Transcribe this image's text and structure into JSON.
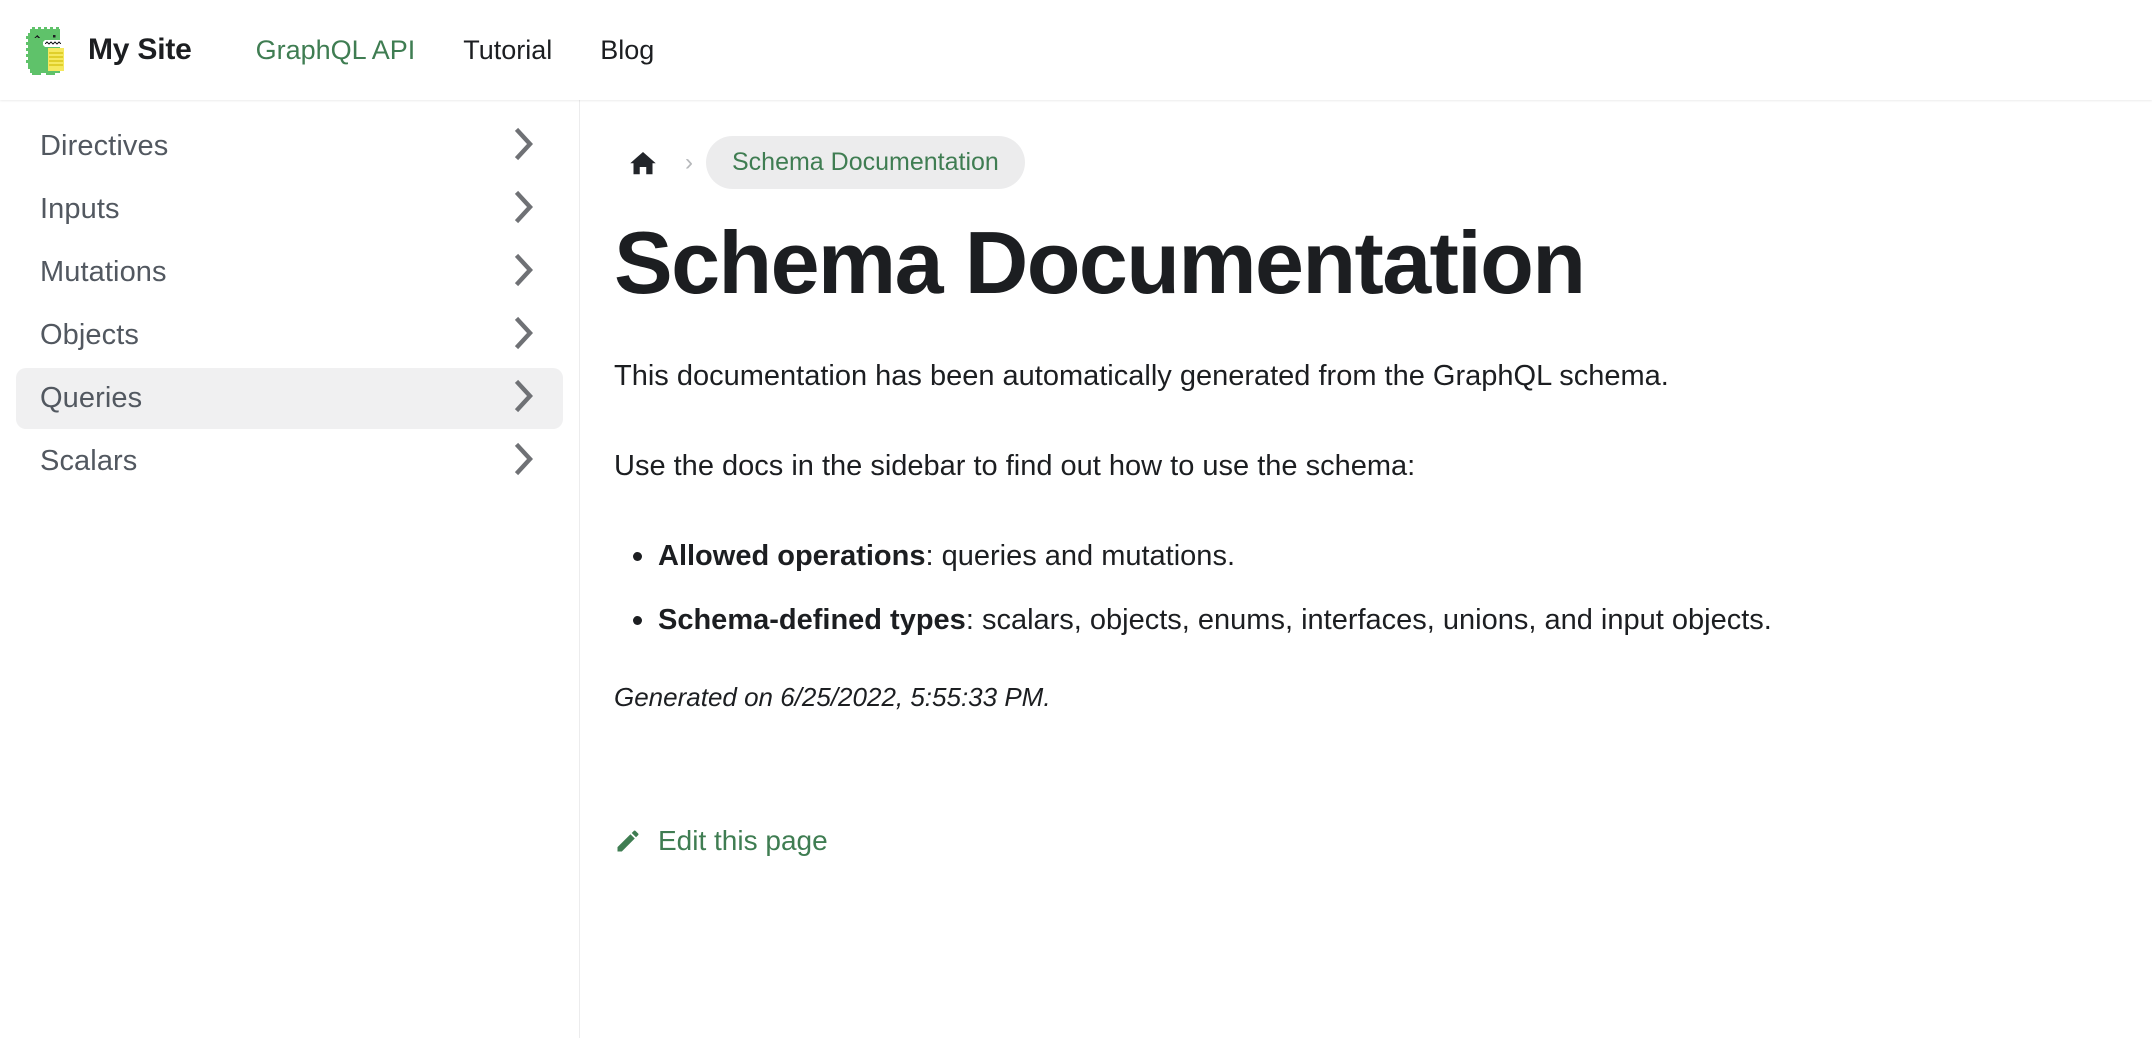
{
  "navbar": {
    "logo_icon": "docusaurus-dino-logo",
    "brand_title": "My Site",
    "items": [
      {
        "label": "GraphQL API",
        "active": true
      },
      {
        "label": "Tutorial",
        "active": false
      },
      {
        "label": "Blog",
        "active": false
      }
    ]
  },
  "sidebar": {
    "items": [
      {
        "label": "Directives",
        "active": false,
        "icon": "chevron-right-icon"
      },
      {
        "label": "Inputs",
        "active": false,
        "icon": "chevron-right-icon"
      },
      {
        "label": "Mutations",
        "active": false,
        "icon": "chevron-right-icon"
      },
      {
        "label": "Objects",
        "active": false,
        "icon": "chevron-right-icon"
      },
      {
        "label": "Queries",
        "active": true,
        "icon": "chevron-right-icon"
      },
      {
        "label": "Scalars",
        "active": false,
        "icon": "chevron-right-icon"
      }
    ]
  },
  "breadcrumb": {
    "home_icon": "home-icon",
    "separator": "›",
    "current": "Schema Documentation"
  },
  "main": {
    "title": "Schema Documentation",
    "paragraph_1": "This documentation has been automatically generated from the GraphQL schema.",
    "paragraph_2": "Use the docs in the sidebar to find out how to use the schema:",
    "bullets": [
      {
        "term": "Allowed operations",
        "rest": ": queries and mutations."
      },
      {
        "term": "Schema-defined types",
        "rest": ": scalars, objects, enums, interfaces, unions, and input objects."
      }
    ],
    "generated": "Generated on 6/25/2022, 5:55:33 PM.",
    "edit_link": "Edit this page",
    "edit_icon": "pencil-icon"
  },
  "colors": {
    "brand_green": "#3f7d52",
    "text_primary": "#1c1e21",
    "text_sidebar": "#525860",
    "pill_bg": "#ececed",
    "active_bg": "#f0f0f1",
    "border": "#ececed",
    "logo_green": "#5fc26a",
    "logo_yellow": "#f5e960"
  }
}
